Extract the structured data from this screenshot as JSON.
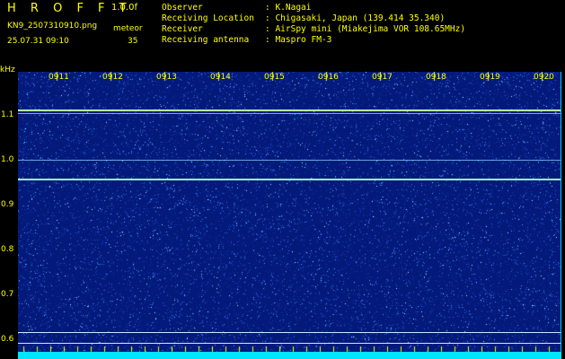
{
  "header": {
    "app_title": "H R O F F T",
    "version": "1.0.0f",
    "file_name": "KN9_2507310910.png",
    "datetime": "25.07.31 09:10",
    "meteor_label": "meteor",
    "meteor_count": "35"
  },
  "info": [
    {
      "key": "Observer",
      "value": ": K.Nagai"
    },
    {
      "key": "Receiving Location",
      "value": ": Chigasaki, Japan (139.414 35.340)"
    },
    {
      "key": "Receiver",
      "value": ": AirSpy mini (Miakejima VOR 108.65MHz)"
    },
    {
      "key": "Receiving antenna",
      "value": ": Maspro FM-3"
    }
  ],
  "axes": {
    "y_unit": "kHz",
    "y_ticks": [
      "1.1",
      "1.0",
      "0.9",
      "0.8",
      "0.7",
      "0.6"
    ],
    "time_ticks": [
      "0911",
      "0912",
      "0913",
      "0914",
      "0915",
      "0916",
      "0917",
      "0918",
      "0919",
      "0920"
    ]
  },
  "colors": {
    "background": "#041a7a",
    "text": "#ffff00",
    "signal_line": "#b8ff9a",
    "bottom_bar": "#00e5ff"
  }
}
